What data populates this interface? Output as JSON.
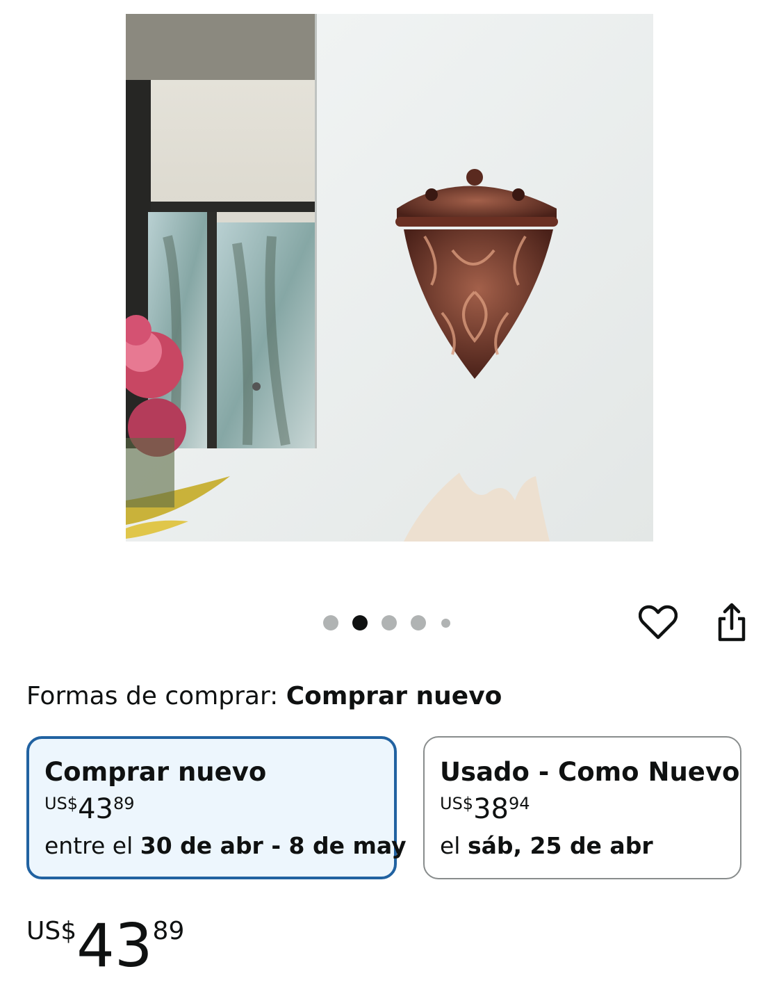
{
  "carousel": {
    "count": 5,
    "active_index": 1
  },
  "icons": {
    "favorite": "heart-icon",
    "share": "share-icon"
  },
  "buying_options": {
    "label": "Formas de comprar:",
    "selected": "Comprar nuevo"
  },
  "options": [
    {
      "title": "Comprar nuevo",
      "price": {
        "symbol": "US$",
        "whole": "43",
        "fraction": "89"
      },
      "delivery_prefix": "entre el ",
      "delivery_date": "30 de abr - 8 de may",
      "selected": true
    },
    {
      "title": "Usado - Como Nuevo",
      "price": {
        "symbol": "US$",
        "whole": "38",
        "fraction": "94"
      },
      "delivery_prefix": "el ",
      "delivery_date": "sáb, 25 de abr",
      "selected": false
    }
  ],
  "price": {
    "symbol": "US$",
    "whole": "43",
    "fraction": "89"
  },
  "colors": {
    "selected_border": "#2162a1",
    "selected_bg": "#edf6fd",
    "text": "#0f1111"
  }
}
